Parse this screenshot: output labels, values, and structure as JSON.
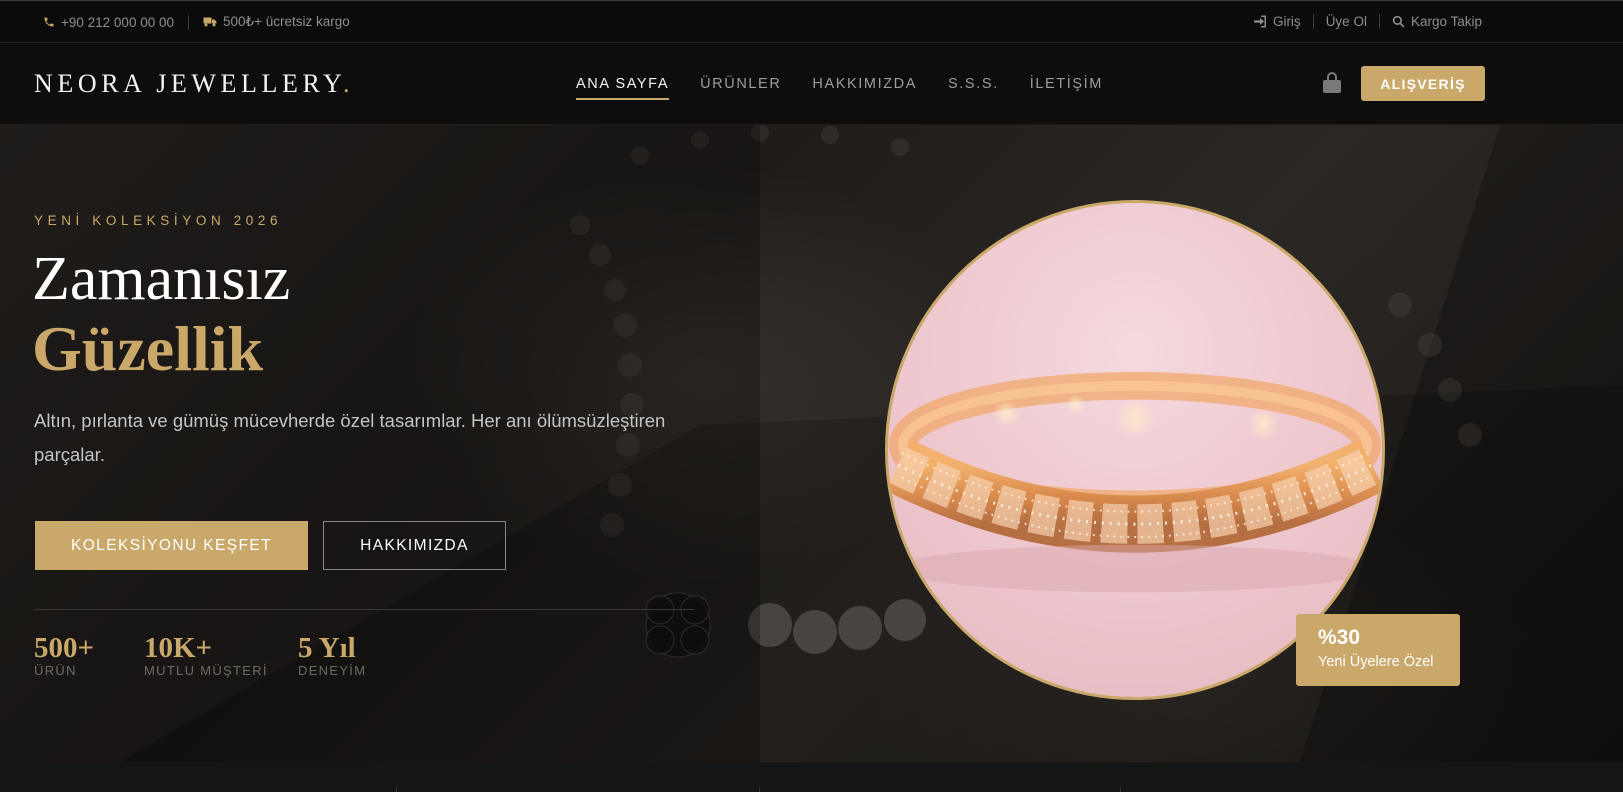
{
  "topbar": {
    "phone": "+90 212 000 00 00",
    "shipping": "500₺+ ücretsiz kargo",
    "login": "Giriş",
    "register": "Üye Ol",
    "tracking": "Kargo Takip"
  },
  "header": {
    "logo_text": "NEORA JEWELLERY",
    "logo_dot": ".",
    "nav": [
      {
        "label": "ANA SAYFA",
        "active": true
      },
      {
        "label": "ÜRÜNLER",
        "active": false
      },
      {
        "label": "HAKKIMIZDA",
        "active": false
      },
      {
        "label": "S.S.S.",
        "active": false
      },
      {
        "label": "İLETİŞİM",
        "active": false
      }
    ],
    "shop_button": "ALIŞVERİŞ"
  },
  "hero": {
    "eyebrow": "YENİ KOLEKSİYON 2026",
    "title_line1": "Zamanısız",
    "title_line2": "Güzellik",
    "lead": "Altın, pırlanta ve gümüş mücevherde özel tasarımlar. Her anı ölümsüzleştiren parçalar.",
    "primary_button": "KOLEKSİYONU KEŞFET",
    "secondary_button": "HAKKIMIZDA",
    "stats": [
      {
        "value": "500+",
        "label": "ÜRÜN"
      },
      {
        "value": "10K+",
        "label": "MUTLU MÜŞTERİ"
      },
      {
        "value": "5 Yıl",
        "label": "DENEYİM"
      }
    ],
    "promo": {
      "value": "%30",
      "text": "Yeni Üyelere Özel"
    }
  },
  "colors": {
    "accent": "#c9a86a",
    "background": "#0d0d0d",
    "hero_bg": "#231f1c"
  },
  "icons": [
    "phone-icon",
    "truck-icon",
    "login-icon",
    "search-icon",
    "shopping-bag-icon"
  ]
}
